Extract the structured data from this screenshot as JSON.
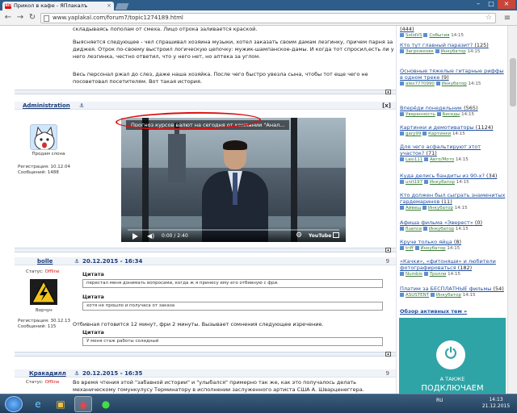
{
  "browser": {
    "tab_title": "Прикол в кафе - ЯПлакалъ",
    "tab_favicon_text": "ЯП",
    "url": "www.yaplakal.com/forum7/topic1274189.html"
  },
  "post_intro": {
    "line0": "складываясь пополам от смеха. Лицо отрока заливается краской.",
    "para1": "Выясняется следующее - чел спрашивал хозяина музыки, хотел заказать своим дамам лезгинку, причем парня за диджея. Отрок по-своему выстроил логическую цепочку: мужик-шампанское-дамы. И когда тот спросил,есть ли у него лезгинка, честно ответил, что у него нет, но аптека за углом.",
    "para2": "Весь персонал ржал до слез, даже наша хозяйка. После чего быстро увезла сына, чтобы тот еще чего не посоветовал посетителям. Вот такая история."
  },
  "admin_post": {
    "author": "Administration",
    "status_label": "Продам слона",
    "reg": "Регистрация: 10.12.04",
    "msgs": "Сообщений: 1488",
    "close_label": "[x]",
    "video": {
      "title": "Прогноз курсов валют на сегодня от компании \"Анал...",
      "time": "0:00 / 2:40",
      "yt": "YouTube"
    }
  },
  "bolle_post": {
    "author": "bolle",
    "date": "20.12.2015 - 16:34",
    "num": "9",
    "status": "Статус:",
    "status_value": "Offline",
    "rank": "Ворчун",
    "reg": "Регистрация: 30.12.13",
    "msgs": "Сообщений: 115",
    "q1_label": "Цитата",
    "q1_text": "перестал меня донимать вопросами, когда ж я принесу ему его отбивную с фри.",
    "q2_label": "Цитата",
    "q2_text": "хотя не прошло и получаса от заказа",
    "body": "Отбивная готовится 12 минут, фри 2 минуты. Вызывает сомнения следующее изречение.",
    "q3_label": "Цитата",
    "q3_text": "У меня стаж работы солидный"
  },
  "krakadil_post": {
    "author": "Кракадилл",
    "date": "20.12.2015 - 16:35",
    "num": "9",
    "status": "Статус:",
    "status_value": "Offline",
    "body": "Во время чтения этой \"забавной истории\" и \"улыбался\" примерно так же, как это получалось делать механическому гомункулусу Терминатору в исполнении заслуженного артиста США А. Шварценеггера."
  },
  "sidebar": {
    "items": [
      {
        "title": "",
        "count": "(444)",
        "user": "SolidVS",
        "section": "События",
        "time": "14:15"
      },
      {
        "title": "Кто тут главный паразит?",
        "count": "(125)",
        "user": "Загрожковк",
        "section": "Инкубатор",
        "time": "14:15"
      },
      {
        "title": "Основные тяжелые гитарные риффы в одном треке",
        "count": "(9)",
        "user": "alex7770990",
        "section": "Инкубатор",
        "time": "14:15"
      },
      {
        "title": "Вперёди понедельник",
        "count": "(565)",
        "user": "Уверенность",
        "section": "Беседы",
        "time": "14:15"
      },
      {
        "title": "Картинки и демотиваторы",
        "count": "(1124)",
        "user": "gary99",
        "section": "Картинки",
        "time": "14:15"
      },
      {
        "title": "Для чего асфальтируют этот участок?",
        "count": "(71)",
        "user": "Lasi111",
        "section": "Авто/Мото",
        "time": "14:15"
      },
      {
        "title": "Куда делись бандиты из 90-х?",
        "count": "(34)",
        "user": "unit197",
        "section": "Инкубатор",
        "time": "14:15"
      },
      {
        "title": "Кто должен был сыграть знаменитых гардемаринов",
        "count": "(11)",
        "user": "Айвещ",
        "section": "Инкубатор",
        "time": "14:15"
      },
      {
        "title": "Афиша фильма «Эверест»",
        "count": "(0)",
        "user": "fluence",
        "section": "Инкубатор",
        "time": "14:15"
      },
      {
        "title": "Круче только яйца",
        "count": "(8)",
        "user": "triff",
        "section": "Инкубатор",
        "time": "14:15"
      },
      {
        "title": "«Качки», «фитоняши» и любители фотографироваться",
        "count": "(182)",
        "user": "Numbis",
        "section": "Тролли",
        "time": "14:15"
      },
      {
        "title": "Платим за БЕСПЛАТНЫЕ фильмы",
        "count": "(54)",
        "user": "ASUSTENT",
        "section": "Инкубатор",
        "time": "14:15"
      }
    ],
    "bottom_link": "Обзор активных тем »"
  },
  "ad": {
    "line1": "А ТАКЖЕ",
    "line2": "ПОДКЛЮЧАЕМ",
    "icon": "power-icon"
  },
  "taskbar": {
    "lang": "RU",
    "time": "14:13",
    "date": "21.12.2015"
  }
}
